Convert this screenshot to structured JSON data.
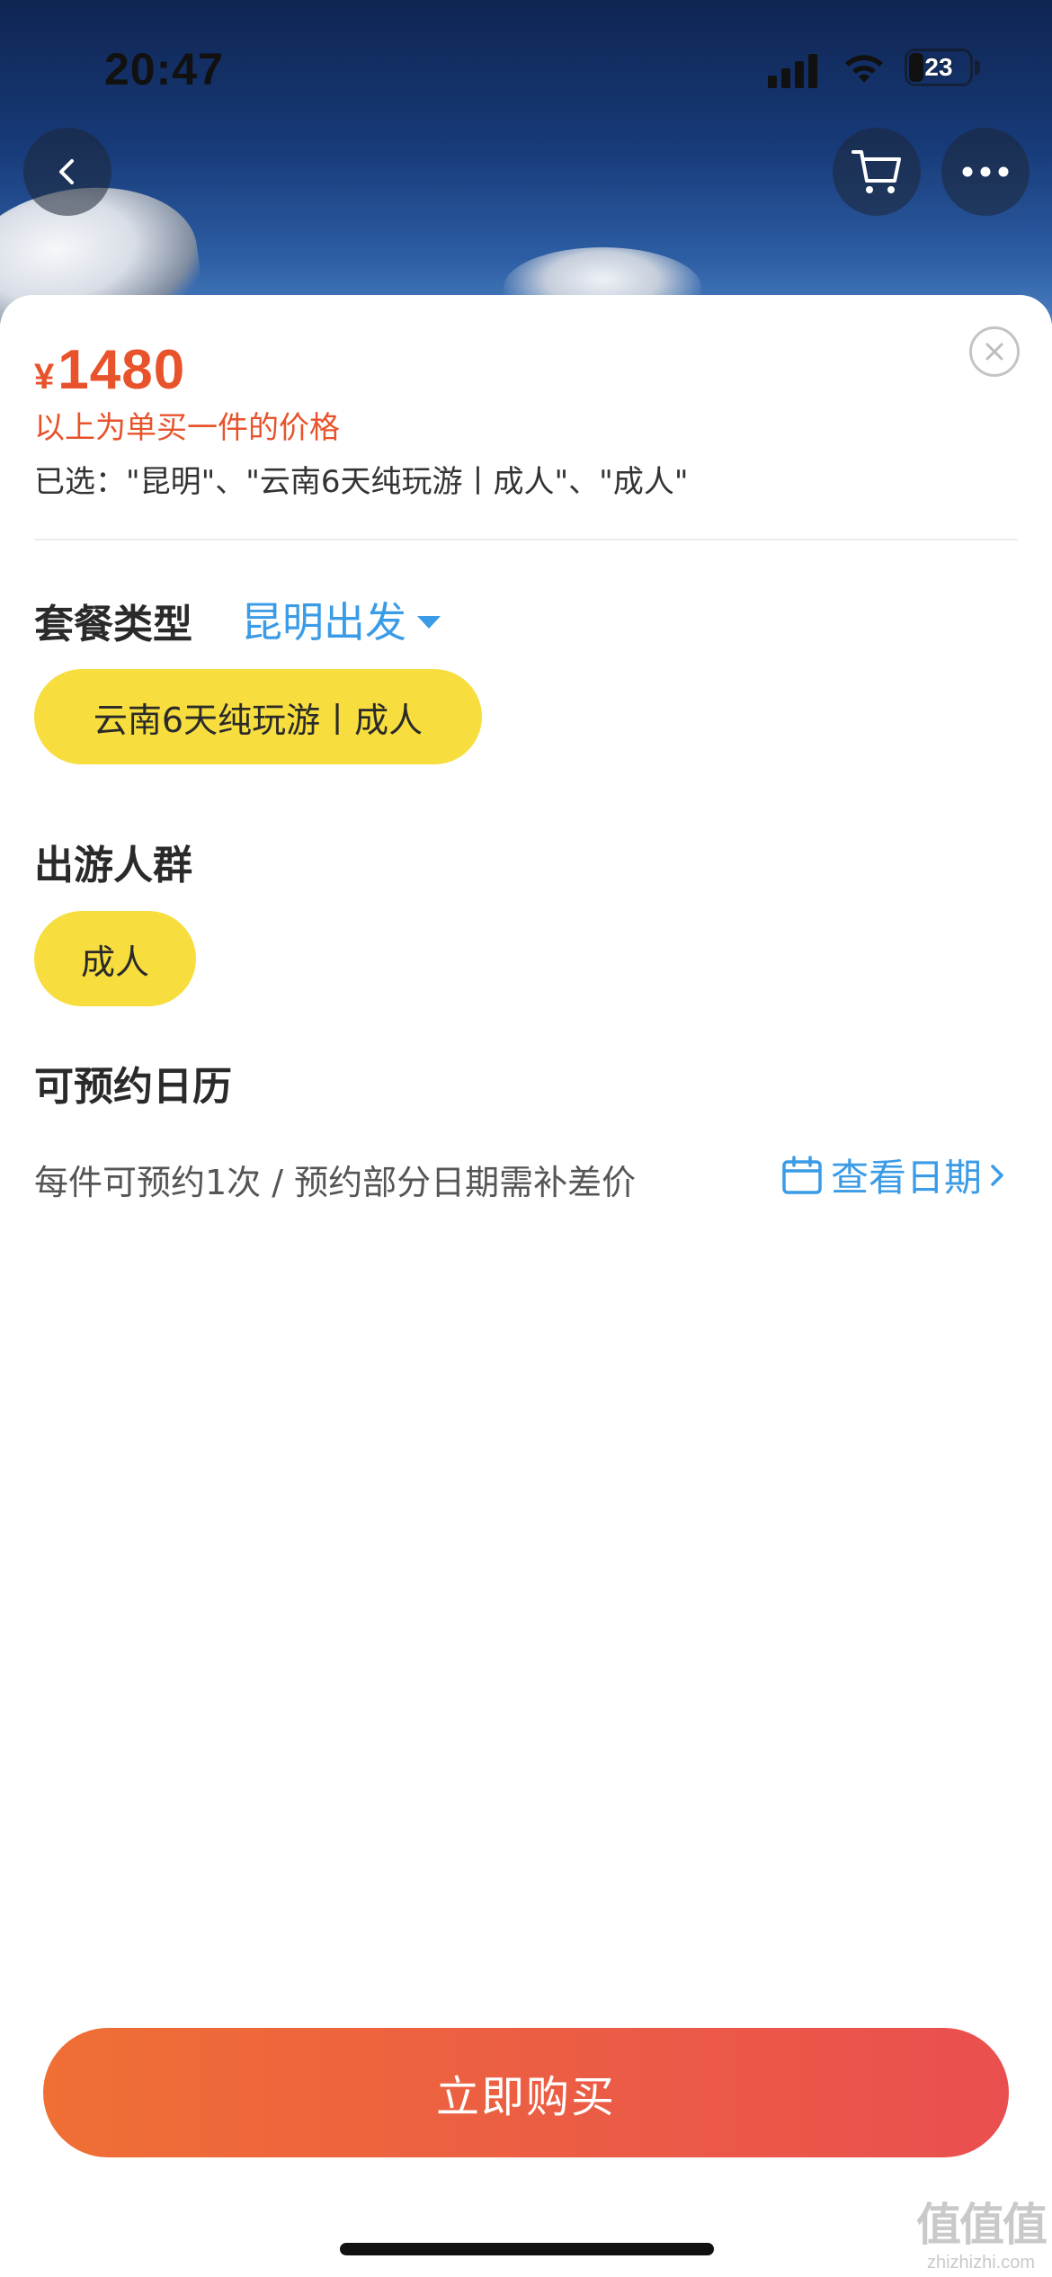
{
  "status_bar": {
    "time": "20:47",
    "battery_level": "23"
  },
  "nav": {
    "back_icon": "chevron-left-icon",
    "cart_icon": "cart-icon",
    "more_icon": "more-icon"
  },
  "sheet": {
    "price_currency": "¥",
    "price_amount": "1480",
    "price_note": "以上为单买一件的价格",
    "selected_text": "已选：\"昆明\"、\"云南6天纯玩游丨成人\"、\"成人\"",
    "package": {
      "title": "套餐类型",
      "departure": "昆明出发",
      "options": [
        {
          "label": "云南6天纯玩游丨成人",
          "selected": true
        }
      ]
    },
    "crowd": {
      "title": "出游人群",
      "options": [
        {
          "label": "成人",
          "selected": true
        }
      ]
    },
    "calendar": {
      "title": "可预约日历",
      "note": "每件可预约1次 / 预约部分日期需补差价",
      "view_dates": "查看日期"
    },
    "buy_button": "立即购买"
  },
  "watermark": {
    "logo": "值值值",
    "url": "zhizhizhi.com"
  },
  "colors": {
    "accent_price": "#e8532b",
    "link_blue": "#3a9be6",
    "chip_yellow": "#f7de3e",
    "buy_gradient_start": "#ef6f34",
    "buy_gradient_end": "#ea4f4f"
  }
}
